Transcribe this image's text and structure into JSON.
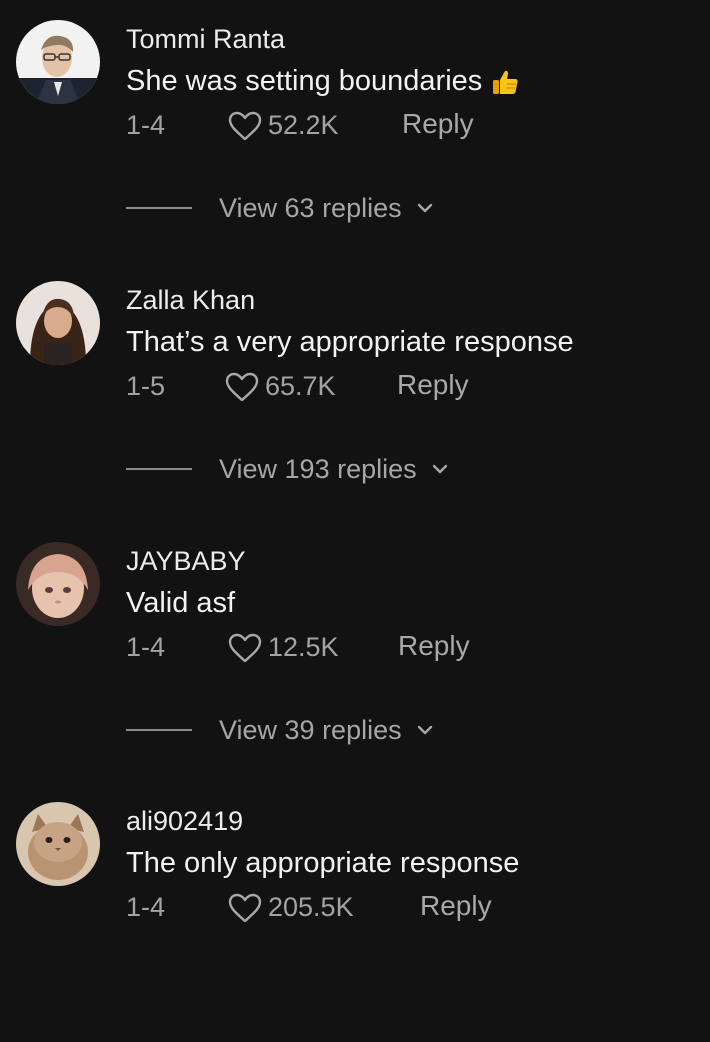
{
  "comments": [
    {
      "username": "Tommi Ranta",
      "text": "She was setting boundaries",
      "emoji_icon": "thumbs-up-icon",
      "date": "1-4",
      "likes": "52.2K",
      "reply_label": "Reply",
      "view_replies": "View 63 replies"
    },
    {
      "username": "Zalla Khan",
      "text": "That’s a very appropriate response",
      "date": "1-5",
      "likes": "65.7K",
      "reply_label": "Reply",
      "view_replies": "View 193 replies"
    },
    {
      "username": "JAYBABY",
      "text": "Valid asf",
      "date": "1-4",
      "likes": "12.5K",
      "reply_label": "Reply",
      "view_replies": "View 39 replies"
    },
    {
      "username": "ali902419",
      "text": "The only appropriate response",
      "date": "1-4",
      "likes": "205.5K",
      "reply_label": "Reply"
    }
  ],
  "colors": {
    "background": "#121212",
    "username": "#ececec",
    "body_text": "#f2f2f2",
    "secondary_text": "#a3a3a3",
    "thumb_emoji": "#f5c518"
  }
}
